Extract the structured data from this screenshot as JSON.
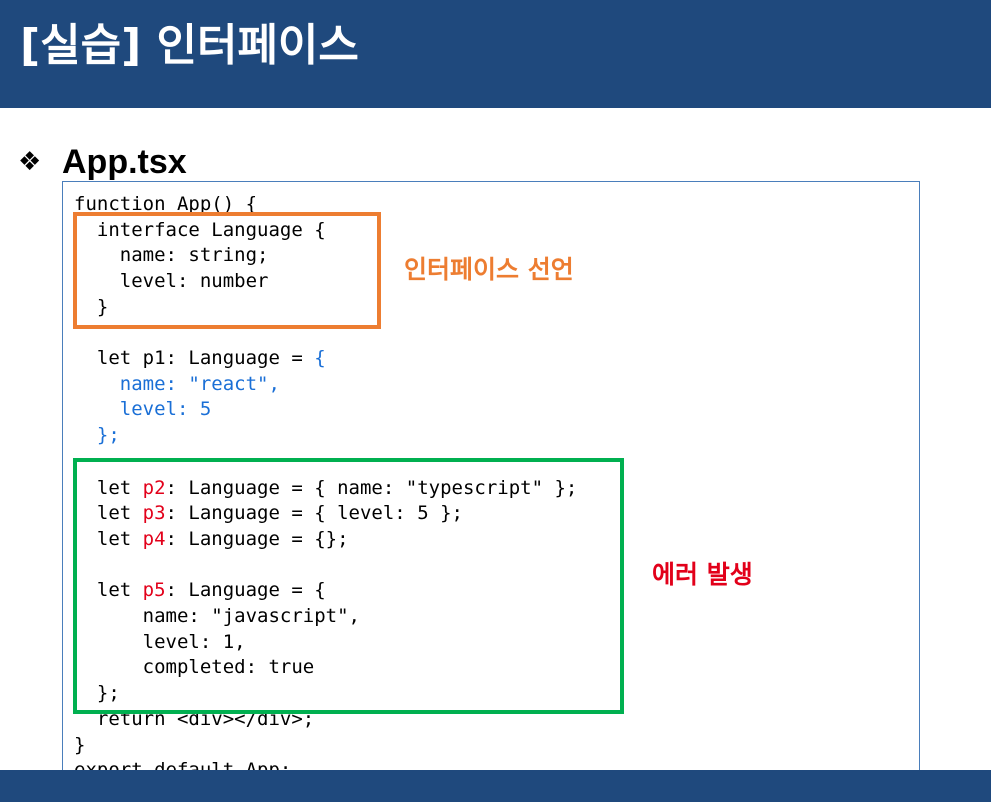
{
  "slide": {
    "title": "[실습] 인터페이스",
    "bullet_icon": "❖",
    "file_name": "App.tsx"
  },
  "colors": {
    "header_bg": "#1f497d",
    "keyword_blue": "#1a6fd6",
    "error_red": "#e2001a",
    "annotation_orange": "#ed7d31",
    "annotation_green": "#00b050"
  },
  "annotations": {
    "interface_declaration": "인터페이스 선언",
    "error_occurs": "에러 발생"
  },
  "code": {
    "l01": "function App() {",
    "l02": "  interface Language {",
    "l03": "    name: string;",
    "l04": "    level: number",
    "l05": "  }",
    "l06": "  let p1: Language = ",
    "l06_obj_open": "{",
    "l07": "    name: \"react\",",
    "l08": "    level: 5",
    "l09": "  };",
    "l10_pre": "  let ",
    "l10_var": "p2",
    "l10_post": ": Language = { name: \"typescript\" };",
    "l11_pre": "  let ",
    "l11_var": "p3",
    "l11_post": ": Language = { level: 5 };",
    "l12_pre": "  let ",
    "l12_var": "p4",
    "l12_post": ": Language = {};",
    "l13_pre": "  let ",
    "l13_var": "p5",
    "l13_post": ": Language = {",
    "l14": "      name: \"javascript\",",
    "l15": "      level: 1,",
    "l16": "      completed: true",
    "l17": "  };",
    "l18": "  return <div></div>;",
    "l19": "}",
    "l20": "export default App;"
  }
}
